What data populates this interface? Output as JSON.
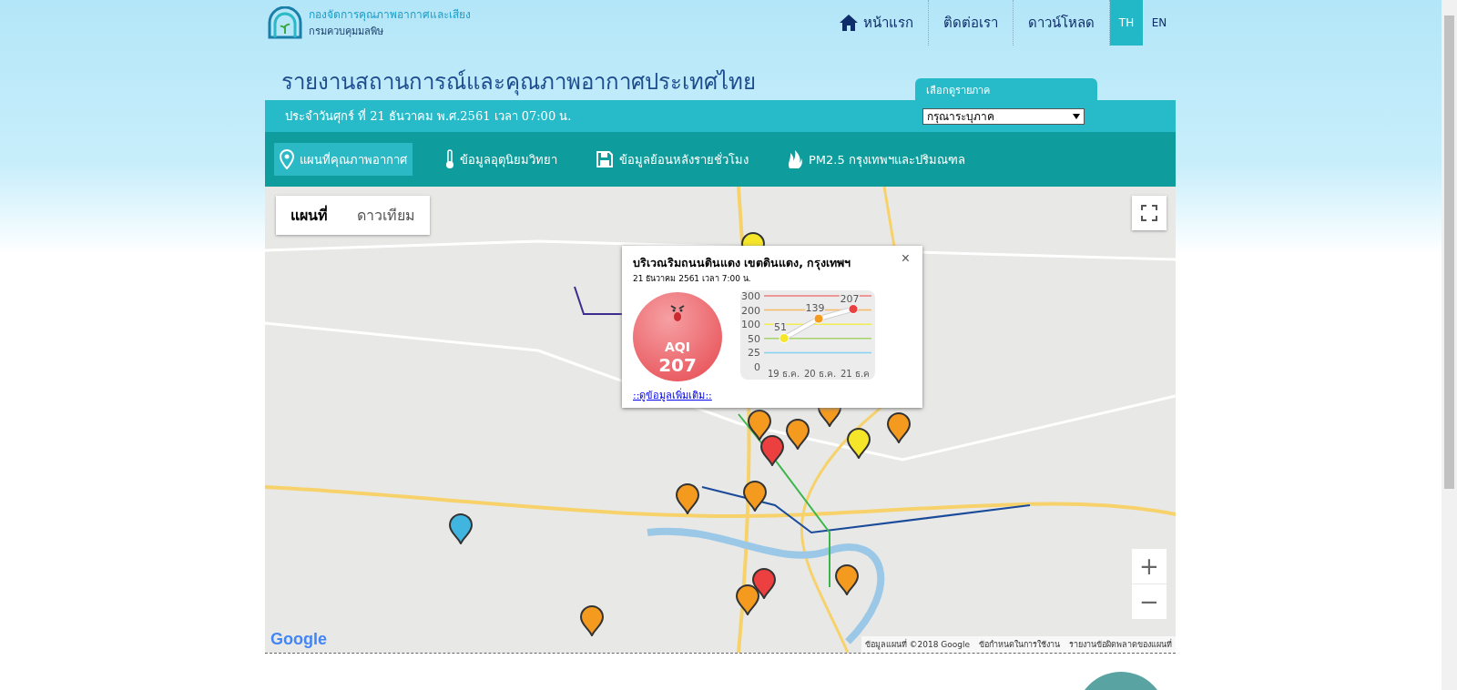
{
  "header": {
    "org_name": "กองจัดการคุณภาพอากาศและเสียง",
    "department": "กรมควบคุมมลพิษ",
    "nav": [
      {
        "label": "หน้าแรก",
        "kind": "home"
      },
      {
        "label": "ติดต่อเรา",
        "kind": "plain"
      },
      {
        "label": "ดาวน์โหลด",
        "kind": "plain"
      }
    ],
    "languages": [
      {
        "label": "TH",
        "selected": true
      },
      {
        "label": "EN",
        "selected": false
      }
    ],
    "title": "รายงานสถานการณ์และคุณภาพอากาศประเทศไทย",
    "region_tab": "เลือกดูรายภาค"
  },
  "date_bar": {
    "date": "ประจำวันศุกร์ ที่ 21 ธันวาคม พ.ศ.2561 เวลา 07:00 น.",
    "region_select": {
      "value": "กรุณาระบุภาค"
    }
  },
  "menu": [
    {
      "label": "แผนที่คุณภาพอากาศ",
      "kind": "map",
      "selected": true
    },
    {
      "label": "ข้อมูลอุตุนิยมวิทยา",
      "kind": "weather",
      "selected": false
    },
    {
      "label": "ข้อมูลย้อนหลังรายชั่วโมง",
      "kind": "history",
      "selected": false
    },
    {
      "label": "PM2.5 กรุงเทพฯและปริมณฑล",
      "kind": "pm",
      "selected": false
    }
  ],
  "map": {
    "map_types": [
      {
        "label": "แผนที่",
        "selected": true
      },
      {
        "label": "ดาวเทียม",
        "selected": false
      }
    ],
    "zoom_in": "+",
    "zoom_out": "−",
    "logo": "Google",
    "attribution": [
      "ข้อมูลแผนที่ ©2018 Google",
      "ข้อกำหนดในการใช้งาน",
      "รายงานข้อผิดพลาดของแผนที่"
    ],
    "markers": [
      {
        "color": "#f5e62a"
      },
      {
        "color": "#f39a1f"
      },
      {
        "color": "#f39a1f"
      },
      {
        "color": "#ec3f3f"
      },
      {
        "color": "#f5e62a"
      },
      {
        "color": "#f39a1f"
      },
      {
        "color": "#f39a1f"
      },
      {
        "color": "#f39a1f"
      },
      {
        "color": "#f39a1f"
      },
      {
        "color": "#3fb5e0"
      },
      {
        "color": "#ec3f3f"
      },
      {
        "color": "#f39a1f"
      },
      {
        "color": "#f39a1f"
      },
      {
        "color": "#f39a1f"
      }
    ],
    "popup": {
      "title": "บริเวณริมถนนดินแดง เขตดินแดง, กรุงเทพฯ",
      "time": "21 ธันวาคม 2561 เวลา 7:00 น.",
      "close": "×",
      "aqi_label": "AQI",
      "aqi_value": "207",
      "more_link": "::ดูข้อมูลเพิ่มเติม::",
      "trend_chart": {
        "y_axis_labels": [
          "300",
          "200",
          "100",
          "50",
          "25",
          "0"
        ],
        "x_labels": [
          "19 ธ.ค.",
          "20 ธ.ค.",
          "21 ธ.ค"
        ],
        "point_labels": [
          "51",
          "139",
          "207"
        ]
      }
    }
  }
}
